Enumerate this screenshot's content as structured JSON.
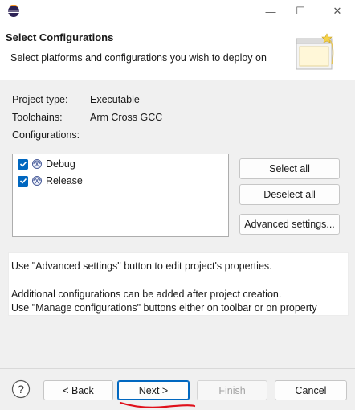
{
  "window": {
    "minimize_glyph": "—",
    "maximize_glyph": "☐",
    "close_glyph": "✕"
  },
  "banner": {
    "title": "Select Configurations",
    "description": "Select platforms and configurations you wish to deploy on"
  },
  "project": {
    "type_label": "Project type:",
    "type_value": "Executable",
    "toolchains_label": "Toolchains:",
    "toolchains_value": "Arm Cross GCC",
    "configurations_label": "Configurations:"
  },
  "configurations": [
    {
      "label": "Debug",
      "checked": true
    },
    {
      "label": "Release",
      "checked": true
    }
  ],
  "side_buttons": {
    "select_all": "Select all",
    "deselect_all": "Deselect all",
    "advanced": "Advanced settings..."
  },
  "info": {
    "line1": "Use \"Advanced settings\" button to edit project's properties.",
    "line2": "Additional configurations can be added after project creation.",
    "line3": "Use \"Manage configurations\" buttons either on toolbar or on property"
  },
  "footer": {
    "back": "< Back",
    "next": "Next >",
    "finish": "Finish",
    "cancel": "Cancel",
    "help_glyph": "?"
  },
  "colors": {
    "accent": "#0067c0",
    "annotation": "#e0101a"
  }
}
